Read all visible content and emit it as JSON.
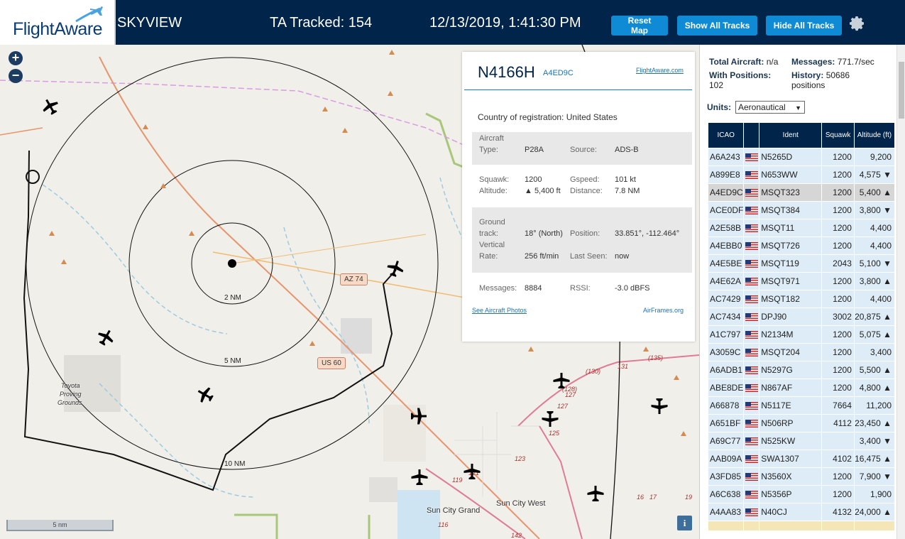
{
  "header": {
    "logo_text": "FlightAware",
    "app_name": "SKYVIEW",
    "ta_tracked": "TA Tracked: 154",
    "datetime": "12/13/2019, 1:41:30 PM",
    "reset_map": "Reset Map",
    "show_all_tracks": "Show All Tracks",
    "hide_all_tracks": "Hide All Tracks"
  },
  "map": {
    "zoom_in": "+",
    "zoom_out": "−",
    "range_rings": [
      "2 NM",
      "5 NM",
      "10 NM"
    ],
    "road_shields": [
      "AZ 74",
      "US 60"
    ],
    "place_labels": [
      "Toyota",
      "Proving",
      "Grounds"
    ],
    "towns": [
      "Sun City Grand",
      "Sun City West"
    ],
    "road_numbers": [
      "(135)",
      "131",
      "(130)",
      "(128)",
      "127",
      "125",
      "123",
      "121",
      "119",
      "116",
      "142",
      "17",
      "16",
      "19",
      "127"
    ],
    "scale": "5 nm",
    "info": "i"
  },
  "selected": {
    "ident": "N4166H",
    "icao": "A4ED9C",
    "flightaware_link": "FlightAware.com",
    "country_label": "Country of registration:",
    "country": "United States",
    "aircraft_type_label_1": "Aircraft",
    "aircraft_type_label_2": "Type:",
    "aircraft_type": "P28A",
    "source_label": "Source:",
    "source": "ADS-B",
    "squawk_label": "Squawk:",
    "squawk": "1200",
    "gspeed_label": "Gspeed:",
    "gspeed": "101 kt",
    "altitude_label": "Altitude:",
    "altitude": "▲ 5,400 ft",
    "distance_label": "Distance:",
    "distance": "7.8 NM",
    "ground_track_label_1": "Ground",
    "ground_track_label_2": "track:",
    "ground_track": "18° (North)",
    "position_label": "Position:",
    "position": "33.851°, -112.464°",
    "vrate_label_1": "Vertical",
    "vrate_label_2": "Rate:",
    "vrate": "256 ft/min",
    "last_seen_label": "Last Seen:",
    "last_seen": "now",
    "messages_label": "Messages:",
    "messages": "8884",
    "rssi_label": "RSSI:",
    "rssi": "-3.0 dBFS",
    "photos_link": "See Aircraft Photos",
    "airframes_link": "AirFrames.org"
  },
  "stats": {
    "total_label": "Total Aircraft:",
    "total": "n/a",
    "messages_label": "Messages:",
    "messages": "771.7/sec",
    "with_pos_label": "With Positions:",
    "with_pos": "102",
    "history_label": "History:",
    "history": "50686",
    "history_unit": "positions",
    "units_label": "Units:",
    "units_value": "Aeronautical"
  },
  "table": {
    "headers": [
      "ICAO",
      "",
      "Ident",
      "Squawk",
      "Altitude (ft)"
    ],
    "rows": [
      {
        "icao": "A6A243",
        "ident": "N5265D",
        "squawk": "1200",
        "alt": "9,200"
      },
      {
        "icao": "A899E8",
        "ident": "N653WW",
        "squawk": "1200",
        "alt": "4,575 ▼"
      },
      {
        "icao": "A4ED9C",
        "ident": "MSQT323",
        "squawk": "1200",
        "alt": "5,400 ▲"
      },
      {
        "icao": "ACE0DF",
        "ident": "MSQT384",
        "squawk": "1200",
        "alt": "3,800 ▼"
      },
      {
        "icao": "A2E58B",
        "ident": "MSQT11",
        "squawk": "1200",
        "alt": "4,400"
      },
      {
        "icao": "A4EBB0",
        "ident": "MSQT726",
        "squawk": "1200",
        "alt": "4,400"
      },
      {
        "icao": "A4E5BE",
        "ident": "MSQT119",
        "squawk": "2043",
        "alt": "5,100 ▼"
      },
      {
        "icao": "A4E62A",
        "ident": "MSQT971",
        "squawk": "1200",
        "alt": "3,800 ▲"
      },
      {
        "icao": "AC7429",
        "ident": "MSQT182",
        "squawk": "1200",
        "alt": "4,400"
      },
      {
        "icao": "AC7434",
        "ident": "DPJ90",
        "squawk": "3002",
        "alt": "20,875 ▲"
      },
      {
        "icao": "A1C797",
        "ident": "N2134M",
        "squawk": "1200",
        "alt": "5,075 ▲"
      },
      {
        "icao": "A3059C",
        "ident": "MSQT204",
        "squawk": "1200",
        "alt": "3,400"
      },
      {
        "icao": "A6ADB1",
        "ident": "N5297G",
        "squawk": "1200",
        "alt": "5,500 ▲"
      },
      {
        "icao": "ABE8DE",
        "ident": "N867AF",
        "squawk": "1200",
        "alt": "4,800 ▲"
      },
      {
        "icao": "A66878",
        "ident": "N5117E",
        "squawk": "7664",
        "alt": "11,200"
      },
      {
        "icao": "A651BF",
        "ident": "N506RP",
        "squawk": "4112",
        "alt": "23,450 ▲"
      },
      {
        "icao": "A69C77",
        "ident": "N525KW",
        "squawk": "",
        "alt": "3,400 ▼"
      },
      {
        "icao": "AAB09A",
        "ident": "SWA1307",
        "squawk": "4102",
        "alt": "16,475 ▲"
      },
      {
        "icao": "A3FD85",
        "ident": "N3560X",
        "squawk": "1200",
        "alt": "7,900 ▼"
      },
      {
        "icao": "A6C638",
        "ident": "N5356P",
        "squawk": "1200",
        "alt": "1,900"
      },
      {
        "icao": "A4AA83",
        "ident": "N40CJ",
        "squawk": "4132",
        "alt": "24,000 ▲"
      }
    ],
    "selected_row": 2
  },
  "colors": {
    "header_bg": "#00244a",
    "button_blue": "#0f8bd6",
    "row_bg": "#ddecf6",
    "selected_row_bg": "#d6d6d6"
  }
}
